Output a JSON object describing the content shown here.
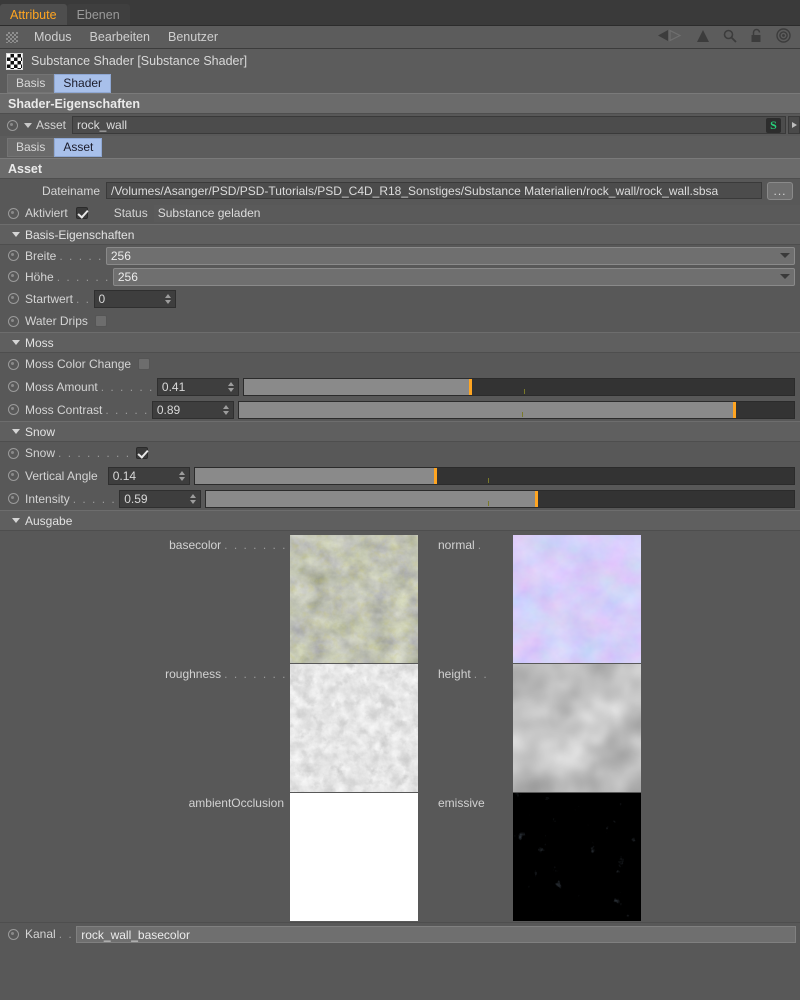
{
  "window": {
    "tabs": [
      {
        "label": "Attribute",
        "active": true
      },
      {
        "label": "Ebenen",
        "active": false
      }
    ]
  },
  "menubar": {
    "grip_icon": "grip-dots-icon",
    "items": [
      "Modus",
      "Bearbeiten",
      "Benutzer"
    ],
    "right_icons": [
      "back-arrow-icon",
      "forward-arrow-icon",
      "up-arrow-icon",
      "search-icon",
      "lock-icon",
      "target-icon"
    ]
  },
  "object": {
    "icon": "checkerboard-icon",
    "title": "Substance Shader [Substance Shader]",
    "tabs": [
      {
        "label": "Basis",
        "selected": false
      },
      {
        "label": "Shader",
        "selected": true
      }
    ]
  },
  "shader_properties": {
    "header": "Shader-Eigenschaften",
    "asset_label": "Asset",
    "asset_value": "rock_wall",
    "asset_icon": "substance-s-icon",
    "link_arrow_icon": "chevron-right-icon",
    "tabs": [
      {
        "label": "Basis",
        "selected": false
      },
      {
        "label": "Asset",
        "selected": true
      }
    ]
  },
  "asset_section": {
    "header": "Asset",
    "filename_label": "Dateiname",
    "filename_value": "/Volumes/Asanger/PSD/PSD-Tutorials/PSD_C4D_R18_Sonstiges/Substance Materialien/rock_wall/rock_wall.sbsa",
    "browse_label": "...",
    "enabled_label": "Aktiviert",
    "enabled_checked": true,
    "status_label": "Status",
    "status_value": "Substance geladen"
  },
  "basis_properties": {
    "header": "Basis-Eigenschaften",
    "rows": [
      {
        "label": "Breite",
        "dots": ". . . . .",
        "type": "dropdown",
        "value": "256"
      },
      {
        "label": "Höhe",
        "dots": ". . . . . .",
        "type": "dropdown",
        "value": "256"
      },
      {
        "label": "Startwert",
        "dots": ". .",
        "type": "number",
        "value": "0"
      },
      {
        "label": "Water Drips",
        "dots": "",
        "type": "checkbox",
        "checked": false
      }
    ]
  },
  "moss": {
    "header": "Moss",
    "rows": [
      {
        "label": "Moss Color Change",
        "dots": "",
        "type": "checkbox",
        "checked": false
      },
      {
        "label": "Moss Amount",
        "dots": ". . . . . .",
        "type": "slider",
        "value": "0.41",
        "fill": 41,
        "tick": 51
      },
      {
        "label": "Moss Contrast",
        "dots": ". . . . .",
        "type": "slider",
        "value": "0.89",
        "fill": 89,
        "tick": 51
      }
    ]
  },
  "snow": {
    "header": "Snow",
    "rows": [
      {
        "label": "Snow",
        "dots": ". . . . . . . .",
        "type": "checkbox",
        "checked": true
      },
      {
        "label": "Vertical Angle",
        "dots": "",
        "type": "slider",
        "value": "0.14",
        "fill": 40,
        "tick": 49
      },
      {
        "label": "Intensity",
        "dots": ". . . . .",
        "type": "slider",
        "value": "0.59",
        "fill": 56,
        "tick": 48
      }
    ]
  },
  "output": {
    "header": "Ausgabe",
    "maps": [
      {
        "label": "basecolor",
        "dots": ". . . . . . .",
        "map": "basecolor"
      },
      {
        "label": "normal",
        "dots": ".",
        "map": "normal"
      },
      {
        "label": "roughness",
        "dots": ". . . . . . .",
        "map": "roughness"
      },
      {
        "label": "height",
        "dots": ". .",
        "map": "height"
      },
      {
        "label": "ambientOcclusion",
        "dots": "",
        "map": "ambientOcclusion"
      },
      {
        "label": "emissive",
        "dots": "",
        "map": "emissive"
      }
    ]
  },
  "channel": {
    "label": "Kanal",
    "dots": ". .",
    "value": "rock_wall_basecolor"
  },
  "colors": {
    "accent_orange": "#ffa521",
    "selected_tab_blue": "#a8c0ea",
    "panel_bg": "#585858",
    "substance_green": "#27d07a"
  }
}
